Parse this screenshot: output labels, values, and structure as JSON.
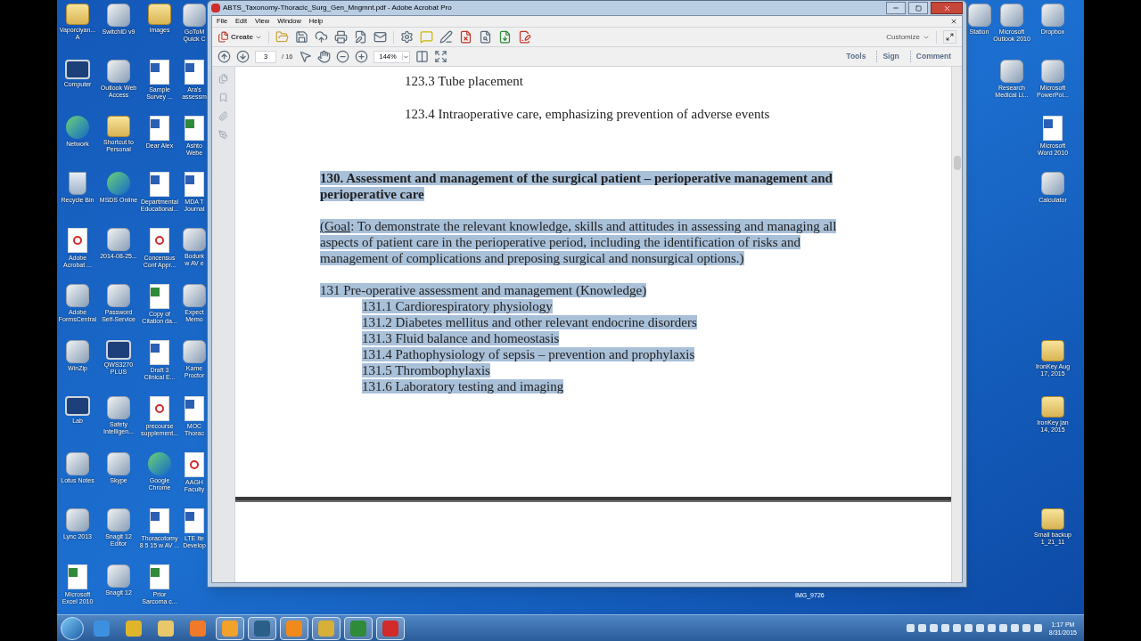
{
  "desktop": {
    "left_columns": [
      [
        {
          "kind": "folder",
          "lines": [
            "Vaporciyan...",
            "A"
          ]
        },
        {
          "kind": "computer",
          "lines": [
            "Computer"
          ]
        },
        {
          "kind": "globe",
          "lines": [
            "Network"
          ]
        },
        {
          "kind": "bin",
          "lines": [
            "Recycle Bin"
          ]
        },
        {
          "kind": "pdf",
          "lines": [
            "Adobe",
            "Acrobat ..."
          ]
        },
        {
          "kind": "program",
          "lines": [
            "Adobe",
            "FormsCentral"
          ]
        },
        {
          "kind": "program",
          "lines": [
            "WinZip"
          ]
        },
        {
          "kind": "computer",
          "lines": [
            "Lab"
          ]
        },
        {
          "kind": "program",
          "lines": [
            "Lotus Notes"
          ]
        },
        {
          "kind": "program",
          "lines": [
            "Lync 2013"
          ]
        },
        {
          "kind": "excel",
          "lines": [
            "Microsoft",
            "Excel 2010"
          ]
        }
      ],
      [
        {
          "kind": "program",
          "lines": [
            "SwitchID v9"
          ]
        },
        {
          "kind": "program",
          "lines": [
            "Outlook Web",
            "Access"
          ]
        },
        {
          "kind": "folder",
          "lines": [
            "Shortcut to",
            "Personal"
          ]
        },
        {
          "kind": "globe",
          "lines": [
            "MSDS Online"
          ]
        },
        {
          "kind": "program",
          "lines": [
            "2014-08-25..."
          ]
        },
        {
          "kind": "program",
          "lines": [
            "Password",
            "Self-Service"
          ]
        },
        {
          "kind": "computer",
          "lines": [
            "QWS3270",
            "PLUS"
          ]
        },
        {
          "kind": "program",
          "lines": [
            "Safety",
            "Intelligen..."
          ]
        },
        {
          "kind": "program",
          "lines": [
            "Skype"
          ]
        },
        {
          "kind": "program",
          "lines": [
            "Snagit 12",
            "Editor"
          ]
        },
        {
          "kind": "program",
          "lines": [
            "Snagit 12"
          ]
        }
      ],
      [
        {
          "kind": "folder",
          "lines": [
            "Images"
          ]
        },
        {
          "kind": "word",
          "lines": [
            "Sample",
            "Survey ..."
          ]
        },
        {
          "kind": "word",
          "lines": [
            "Dear Alex"
          ]
        },
        {
          "kind": "word",
          "lines": [
            "Departmental",
            "Educational..."
          ]
        },
        {
          "kind": "pdf",
          "lines": [
            "Concensus",
            "Conf Appr..."
          ]
        },
        {
          "kind": "excel",
          "lines": [
            "Copy of",
            "Citation da..."
          ]
        },
        {
          "kind": "word",
          "lines": [
            "Draft 3",
            "Clinical E..."
          ]
        },
        {
          "kind": "pdf",
          "lines": [
            "precourse",
            "supplement..."
          ]
        },
        {
          "kind": "globe",
          "lines": [
            "Google",
            "Chrome"
          ]
        },
        {
          "kind": "word",
          "lines": [
            "Thoracotomy",
            "8 5 15 w AV ..."
          ]
        },
        {
          "kind": "excel",
          "lines": [
            "Prior",
            "Sarcoma c..."
          ]
        }
      ],
      [
        {
          "kind": "program",
          "lines": [
            "GoToM",
            "Quick C"
          ]
        },
        {
          "kind": "word",
          "lines": [
            "Ara's",
            "assessm"
          ]
        },
        {
          "kind": "excel",
          "lines": [
            "Ashto",
            "Webe"
          ]
        },
        {
          "kind": "word",
          "lines": [
            "MDA T",
            "Journal"
          ]
        },
        {
          "kind": "program",
          "lines": [
            "Bodurk",
            "w AV e"
          ]
        },
        {
          "kind": "program",
          "lines": [
            "Expect",
            "Memo"
          ]
        },
        {
          "kind": "program",
          "lines": [
            "Kame",
            "Proctor"
          ]
        },
        {
          "kind": "word",
          "lines": [
            "MOC",
            "Thorac"
          ]
        },
        {
          "kind": "pdf",
          "lines": [
            "AAGH",
            "Faculty"
          ]
        },
        {
          "kind": "word",
          "lines": [
            "LTE Ite",
            "Develop"
          ]
        }
      ]
    ],
    "right_partial": [
      {
        "kind": "program",
        "lines": [
          "Station"
        ]
      }
    ],
    "right_columns": [
      [
        {
          "kind": "program",
          "lines": [
            "Microsoft",
            "Outlook 2010"
          ]
        },
        {
          "kind": "program",
          "lines": [
            "Research",
            "Medical Li..."
          ]
        }
      ],
      [
        {
          "kind": "program",
          "lines": [
            "Dropbox"
          ]
        },
        {
          "kind": "program",
          "lines": [
            "Microsoft",
            "PowerPoi..."
          ]
        },
        {
          "kind": "word",
          "lines": [
            "Microsoft",
            "Word 2010"
          ]
        },
        {
          "kind": "program",
          "lines": [
            "Calculator"
          ]
        },
        {
          "kind": "folder",
          "lines": [
            "IronKey Aug",
            "17, 2015"
          ]
        },
        {
          "kind": "folder",
          "lines": [
            "IronKey jan",
            "14, 2015"
          ]
        },
        {
          "kind": "folder",
          "lines": [
            "Small backup",
            "1_21_11"
          ]
        }
      ]
    ],
    "bottom_label": "IMG_9726"
  },
  "window": {
    "title": "ABTS_Taxonomy-Thoracic_Surg_Gen_Mngmnt.pdf - Adobe Acrobat Pro",
    "menu": [
      "File",
      "Edit",
      "View",
      "Window",
      "Help"
    ],
    "create_button": "Create",
    "customize": "Customize",
    "page_number": "3",
    "page_total": "/ 16",
    "zoom": "144%",
    "panes": [
      {
        "label": "Tools",
        "selected": false
      },
      {
        "label": "Sign",
        "selected": false
      },
      {
        "label": "Comment",
        "selected": false
      }
    ]
  },
  "document": {
    "blocks": [
      {
        "kind": "item",
        "text": "123.3 Tube placement",
        "highlighted": false
      },
      {
        "kind": "item",
        "text": "123.4 Intraoperative care, emphasizing prevention of adverse events",
        "highlighted": false
      },
      {
        "kind": "heading",
        "text": "130. Assessment and management of the surgical patient – perioperative management and perioperative care",
        "highlighted": true
      },
      {
        "kind": "paragraph",
        "lead": "(Goal",
        "text": ":  To demonstrate the relevant knowledge, skills and attitudes in assessing and managing all aspects of patient care in the perioperative period, including the identification of risks and management of complications and preposing surgical and nonsurgical options.)",
        "highlighted": true
      },
      {
        "kind": "list",
        "text": "131 Pre-operative assessment and management (Knowledge)",
        "highlighted": true,
        "children": [
          {
            "text": "131.1 Cardiorespiratory physiology",
            "highlighted": true
          },
          {
            "text": "131.2 Diabetes mellitus and other relevant endocrine disorders",
            "highlighted": true
          },
          {
            "text": "131.3 Fluid balance and homeostasis",
            "highlighted": true
          },
          {
            "text": "131.4 Pathophysiology of sepsis – prevention and prophylaxis",
            "highlighted": true
          },
          {
            "text": "131.5 Thrombophylaxis",
            "highlighted": true
          },
          {
            "text": "131.6 Laboratory testing and imaging",
            "highlighted": true
          }
        ]
      }
    ]
  },
  "taskbar": {
    "apps": [
      {
        "kind": "ie",
        "running": false
      },
      {
        "kind": "chrome",
        "running": false
      },
      {
        "kind": "explorer",
        "running": false
      },
      {
        "kind": "media",
        "running": false
      },
      {
        "kind": "outlook",
        "running": true
      },
      {
        "kind": "snagit",
        "running": true
      },
      {
        "kind": "flower",
        "running": true
      },
      {
        "kind": "winzip",
        "running": true
      },
      {
        "kind": "excel",
        "running": true
      },
      {
        "kind": "acrobat",
        "running": true
      }
    ],
    "time": "1:17 PM",
    "date": "8/31/2015"
  }
}
